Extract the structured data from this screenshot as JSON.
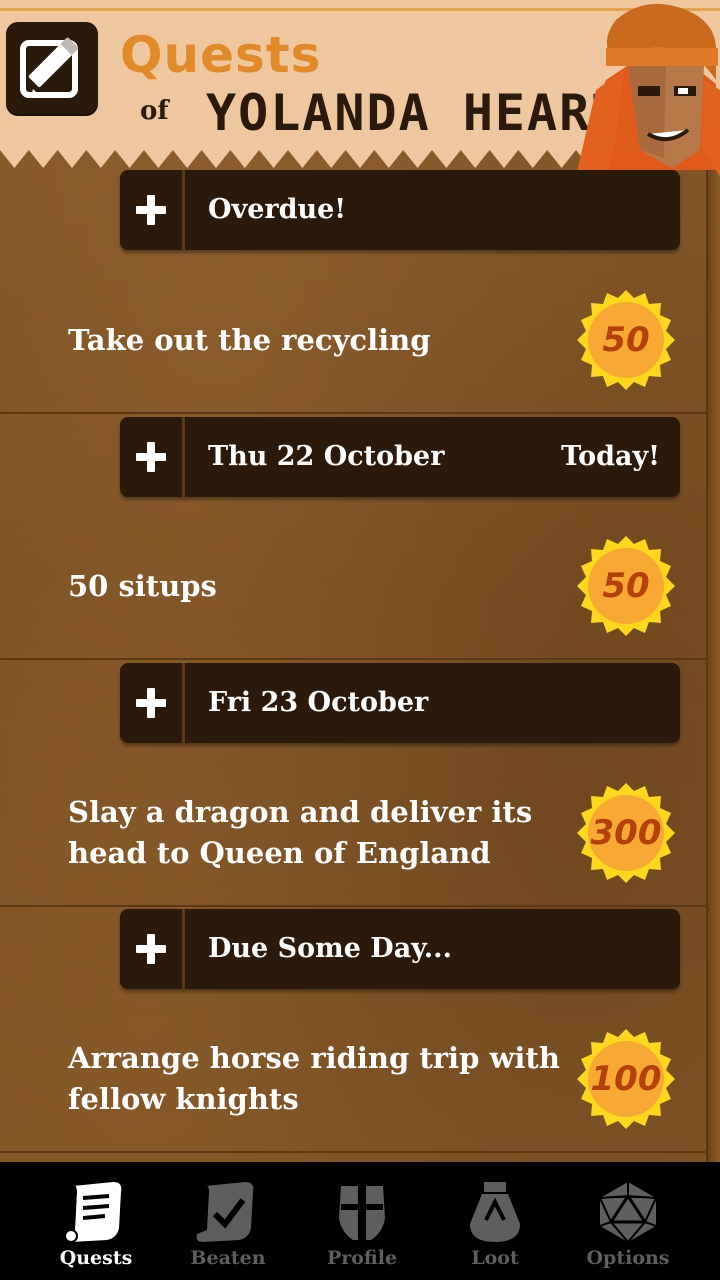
{
  "header": {
    "title": "Quests",
    "of": "of",
    "hero_name": "YOLANDA HEARTBREAKER"
  },
  "sections": [
    {
      "label": "Overdue!",
      "badge": ""
    },
    {
      "label": "Thu 22 October",
      "badge": "Today!"
    },
    {
      "label": "Fri 23 October",
      "badge": ""
    },
    {
      "label": "Due Some Day...",
      "badge": ""
    }
  ],
  "quests": [
    {
      "text": "Take out the recycling",
      "reward": "50"
    },
    {
      "text": "50 situps",
      "reward": "50"
    },
    {
      "text": "Slay a dragon and deliver its head to Queen of England",
      "reward": "300"
    },
    {
      "text": "Arrange horse riding trip with fellow knights",
      "reward": "100"
    }
  ],
  "tabs": [
    {
      "label": "Quests",
      "icon": "scroll-icon",
      "active": true
    },
    {
      "label": "Beaten",
      "icon": "checked-scroll-icon",
      "active": false
    },
    {
      "label": "Profile",
      "icon": "helmet-icon",
      "active": false
    },
    {
      "label": "Loot",
      "icon": "loot-bag-icon",
      "active": false
    },
    {
      "label": "Options",
      "icon": "d20-dice-icon",
      "active": false
    }
  ],
  "colors": {
    "header_bg": "#efc79e",
    "title": "#e08a2a",
    "section_bg": "#2b1a0b",
    "coin": "#f7a934",
    "coin_text": "#b4410a",
    "tab_active": "#ffffff",
    "tab_inactive": "#5e5e5e"
  }
}
